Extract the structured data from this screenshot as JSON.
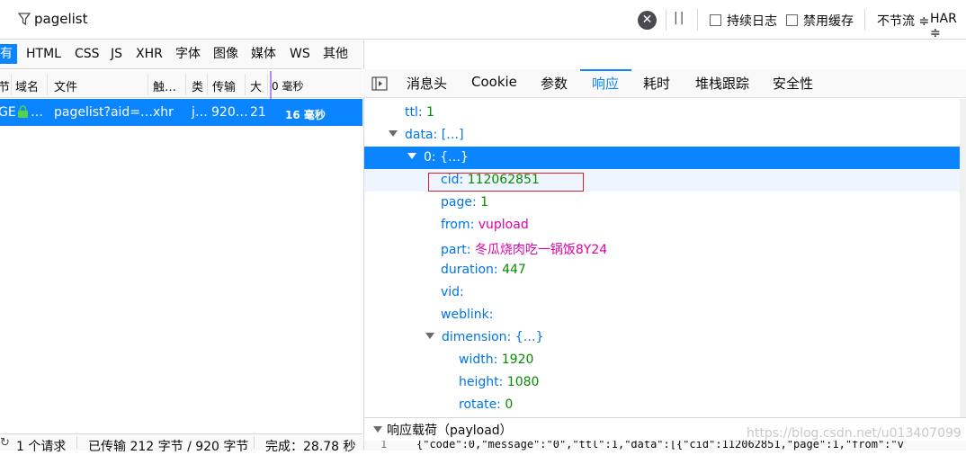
{
  "filter": {
    "text": "pagelist"
  },
  "toolbar": {
    "persist_log": "持续日志",
    "disable_cache": "禁用缓存",
    "throttle": "不节流 ≑",
    "har": "HAR ≑"
  },
  "types": [
    "有",
    "HTML",
    "CSS",
    "JS",
    "XHR",
    "字体",
    "图像",
    "媒体",
    "WS",
    "其他"
  ],
  "columns": [
    "节",
    "域名",
    "文件",
    "触…",
    "类",
    "传输",
    "大",
    "0 毫秒"
  ],
  "request": {
    "method": "GE",
    "domain": "…",
    "file": "pagelist?aid=…",
    "cause": "xhr",
    "type": "j…",
    "transferred": "920…",
    "size": "21",
    "timing": "16 毫秒"
  },
  "detail_tabs": [
    "消息头",
    "Cookie",
    "参数",
    "响应",
    "耗时",
    "堆栈跟踪",
    "安全性"
  ],
  "selected_tab": "响应",
  "json": {
    "ttl_key": "ttl:",
    "ttl_val": "1",
    "data_key": "data:",
    "data_val": "[…]",
    "item0_key": "0:",
    "item0_val": "{…}",
    "cid_key": "cid:",
    "cid_val": "112062851",
    "page_key": "page:",
    "page_val": "1",
    "from_key": "from:",
    "from_val": "vupload",
    "part_key": "part:",
    "part_val": "冬瓜烧肉吃一锅饭8Y24",
    "duration_key": "duration:",
    "duration_val": "447",
    "vid_key": "vid:",
    "weblink_key": "weblink:",
    "dimension_key": "dimension:",
    "dimension_val": "{…}",
    "width_key": "width:",
    "width_val": "1920",
    "height_key": "height:",
    "height_val": "1080",
    "rotate_key": "rotate:",
    "rotate_val": "0"
  },
  "payload": {
    "title": "响应载荷（payload）",
    "line_no": "1",
    "line_text": "{\"code\":0,\"message\":\"0\",\"ttl\":1,\"data\":[{\"cid\":112062851,\"page\":1,\"from\":\"v"
  },
  "status": {
    "requests": "1 个请求",
    "transferred": "已传输 212 字节 / 920 字节",
    "finish": "完成：28.78 秒"
  },
  "watermark": "https://blog.csdn.net/u013407099",
  "colors": {
    "accent": "#0a84ff",
    "json_key": "#0074e8",
    "json_number": "#058b00",
    "json_string": "#dd00a9",
    "highlight_border": "#d6202b"
  }
}
